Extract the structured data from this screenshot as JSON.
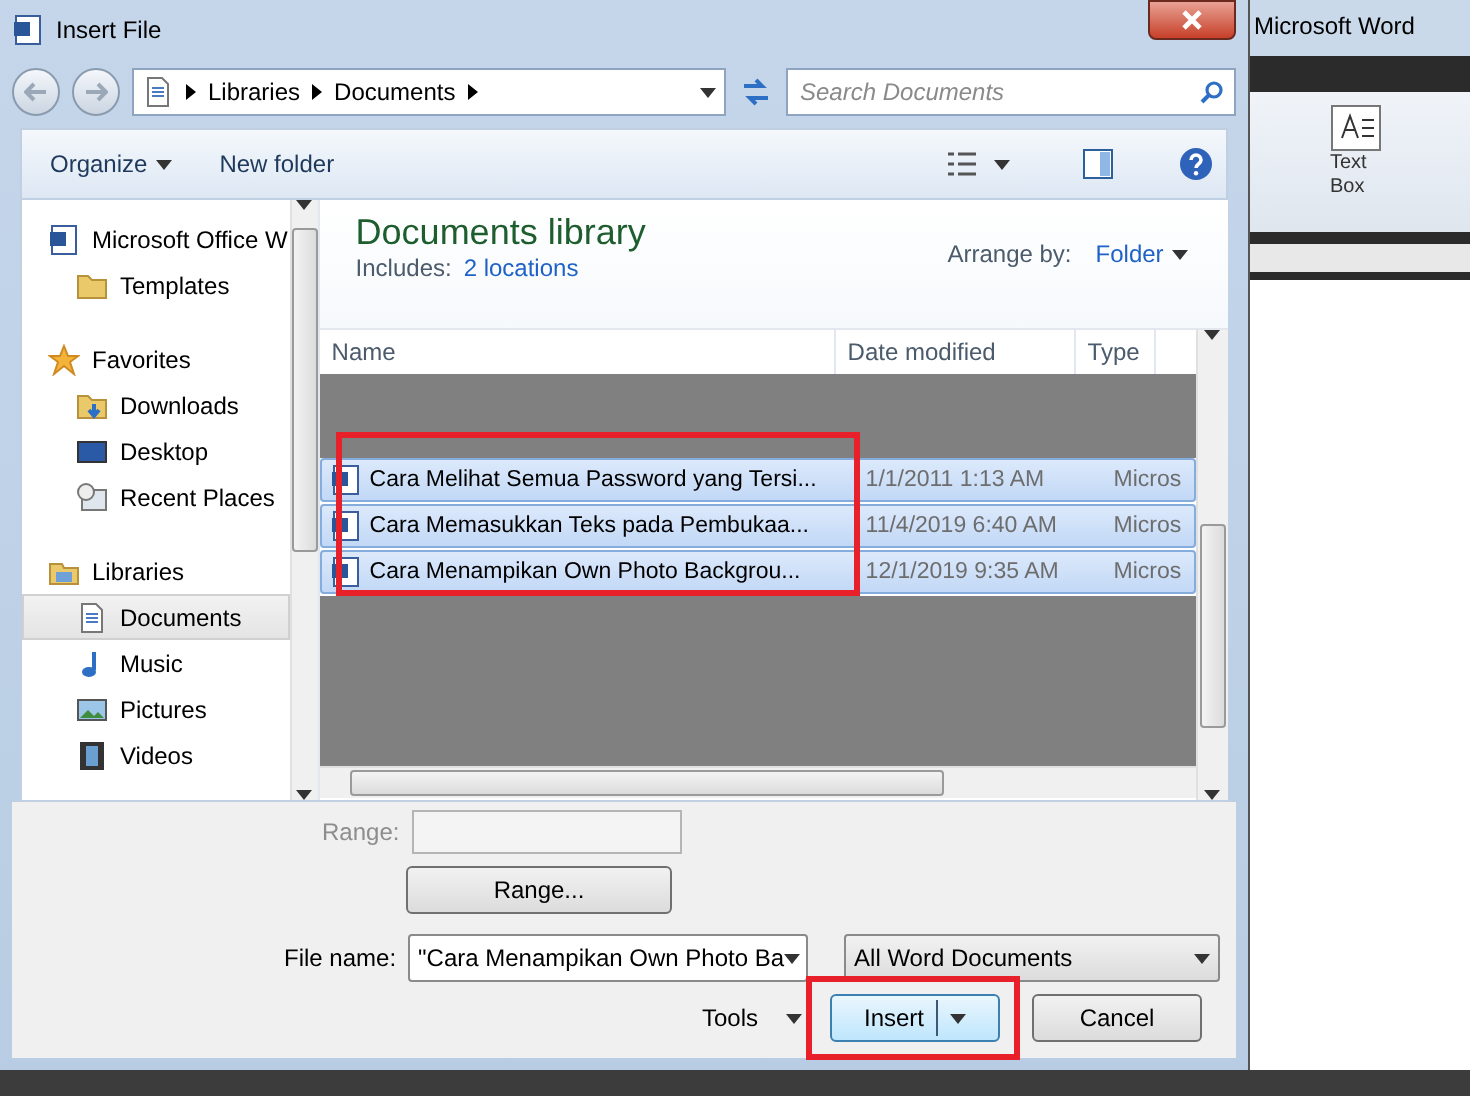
{
  "dialog": {
    "title": "Insert File",
    "breadcrumb": [
      "Libraries",
      "Documents"
    ],
    "search": {
      "placeholder": "Search Documents"
    },
    "toolbar": {
      "organize": "Organize",
      "new_folder": "New folder"
    },
    "nav": [
      {
        "heading": "Microsoft Office W",
        "items": [
          {
            "label": "Templates",
            "selected": false
          }
        ]
      },
      {
        "heading": "Favorites",
        "items": [
          {
            "label": "Downloads",
            "selected": false
          },
          {
            "label": "Desktop",
            "selected": false
          },
          {
            "label": "Recent Places",
            "selected": false
          }
        ]
      },
      {
        "heading": "Libraries",
        "items": [
          {
            "label": "Documents",
            "selected": true
          },
          {
            "label": "Music",
            "selected": false
          },
          {
            "label": "Pictures",
            "selected": false
          },
          {
            "label": "Videos",
            "selected": false
          }
        ]
      }
    ],
    "library": {
      "title": "Documents library",
      "includes_label": "Includes:",
      "includes_link": "2 locations",
      "arrange_label": "Arrange by:",
      "arrange_value": "Folder"
    },
    "columns": [
      "Name",
      "Date modified",
      "Type"
    ],
    "files": [
      {
        "name": "Cara Melihat Semua Password yang Tersi...",
        "date": "1/1/2011 1:13 AM",
        "type": "Micros",
        "selected": true
      },
      {
        "name": "Cara Memasukkan Teks pada Pembukaa...",
        "date": "11/4/2019 6:40 AM",
        "type": "Micros",
        "selected": true
      },
      {
        "name": "Cara Menampikan Own Photo Backgrou...",
        "date": "12/1/2019 9:35 AM",
        "type": "Micros",
        "selected": true
      }
    ],
    "range": {
      "label": "Range:",
      "button": "Range...",
      "disabled": true
    },
    "file_name": {
      "label": "File name:",
      "value": "\"Cara Menampikan Own Photo Ba"
    },
    "file_type": "All Word Documents",
    "tools": "Tools",
    "insert": "Insert",
    "cancel": "Cancel"
  },
  "word": {
    "title": "Microsoft Word",
    "ribbon_label": "Text Box"
  }
}
